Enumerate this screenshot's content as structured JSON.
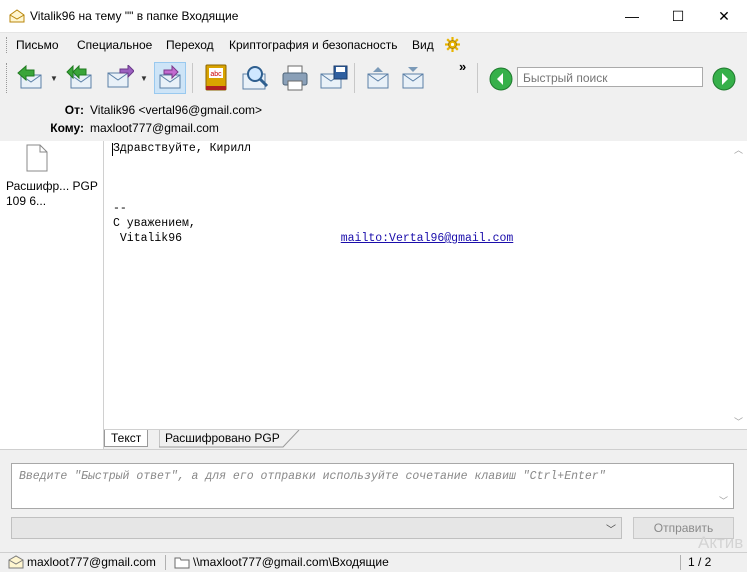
{
  "window": {
    "title": "Vitalik96 на тему \"\" в папке Входящие",
    "minimize": "—",
    "maximize": "☐",
    "close": "✕"
  },
  "menu": [
    "Письмо",
    "Специальное",
    "Переход",
    "Криптография и безопасность",
    "Вид"
  ],
  "toolbar": {
    "icons": [
      "reply-icon",
      "reply-all-icon",
      "forward-icon",
      "redirect-icon",
      "spellcheck-icon",
      "find-icon",
      "print-icon",
      "save-icon",
      "previous-message-icon",
      "next-message-icon"
    ],
    "overflow": "»",
    "search_placeholder": "Быстрый поиск"
  },
  "headers": {
    "from_label": "От:",
    "from_value": "Vitalik96 <vertal96@gmail.com>",
    "to_label": "Кому:",
    "to_value": "maxloot777@gmail.com"
  },
  "attachment": {
    "name": "Расшифр... PGP 109 6..."
  },
  "body": {
    "greeting": "Здравствуйте, Кирилл",
    "signature_sep": "--",
    "regards": "С уважением,",
    "name": " Vitalik96",
    "mailto": "mailto:Vertal96@gmail.com"
  },
  "tabs": [
    "Текст",
    "Расшифровано PGP"
  ],
  "quick_reply": {
    "placeholder": "Введите \"Быстрый ответ\", а для его отправки используйте сочетание клавиш \"Ctrl+Enter\"",
    "send_label": "Отправить"
  },
  "status": {
    "account": "maxloot777@gmail.com",
    "folder": "\\\\maxloot777@gmail.com\\Входящие",
    "counter": "1 / 2"
  },
  "watermark": "Актив",
  "colors": {
    "accent_green": "#3aa53a",
    "link": "#1a0dab",
    "selection": "#cde4f7"
  }
}
